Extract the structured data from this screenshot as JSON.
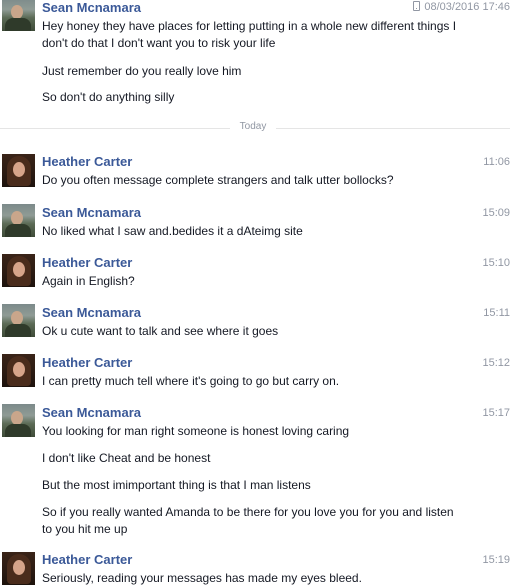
{
  "first_block": {
    "sender": "Sean Mcnamara",
    "timestamp": "08/03/2016 17:46",
    "messages": [
      "Hey honey they have places for letting putting in a whole new different things I don't do that I don't want you to risk your life",
      "Just remember do you really love him",
      "So don't do anything silly"
    ]
  },
  "divider_label": "Today",
  "blocks": [
    {
      "sender": "Heather Carter",
      "time": "11:06",
      "messages": [
        "Do you often message complete strangers and talk utter bollocks?"
      ]
    },
    {
      "sender": "Sean Mcnamara",
      "time": "15:09",
      "messages": [
        "No liked what I saw and.bedides it a dAteimg site"
      ]
    },
    {
      "sender": "Heather Carter",
      "time": "15:10",
      "messages": [
        "Again in English?"
      ]
    },
    {
      "sender": "Sean Mcnamara",
      "time": "15:11",
      "messages": [
        "Ok u cute want to talk and see where it goes"
      ]
    },
    {
      "sender": "Heather Carter",
      "time": "15:12",
      "messages": [
        "I can pretty much tell where it's going to go but carry on."
      ]
    },
    {
      "sender": "Sean Mcnamara",
      "time": "15:17",
      "messages": [
        "You looking for man right someone is honest loving caring",
        "I don't like Cheat and be honest",
        "But the most imimportant thing is that I man listens",
        "So if you really wanted Amanda to be there for you love you for you and listen to you hit me up"
      ]
    },
    {
      "sender": "Heather Carter",
      "time": "15:19",
      "messages": [
        "Seriously, reading your messages has made my eyes bleed."
      ]
    }
  ]
}
